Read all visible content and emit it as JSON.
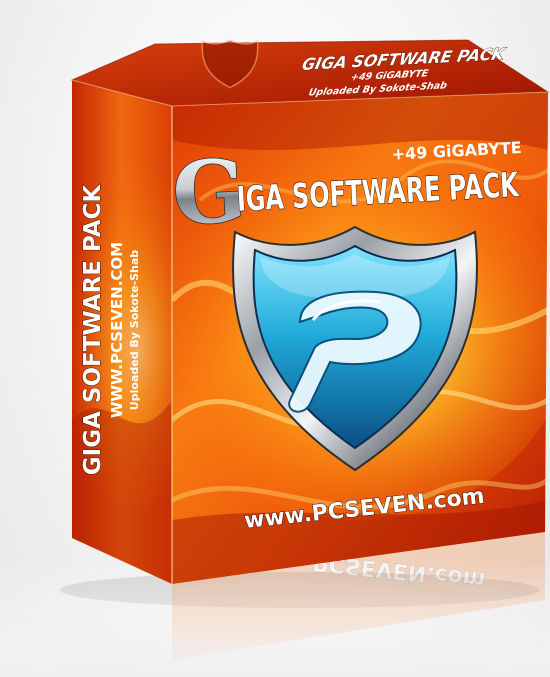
{
  "product": {
    "title_initial": "G",
    "title_rest": "IGA SOFTWARE PACK",
    "size": "+49 GiGABYTE",
    "website": "www.PCSEVEN.com"
  },
  "spine": {
    "title": "GIGA SOFTWARE PACK",
    "website": "WWW.PCSEVEN.COM",
    "uploader": "Uploaded By Sokote-Shab"
  },
  "top_face": {
    "title": "GIGA SOFTWARE PACK",
    "size": "+49 GiGABYTE",
    "uploader": "Uploaded By Sokote-Shab"
  },
  "colors": {
    "box_orange": "#f26a0c",
    "box_red": "#c61f03",
    "flame_yellow": "#ffd43a",
    "shield_blue": "#1aa7d6",
    "silver": "#d9dde2"
  },
  "icons": {
    "emblem": "shield-p-logo-icon"
  }
}
